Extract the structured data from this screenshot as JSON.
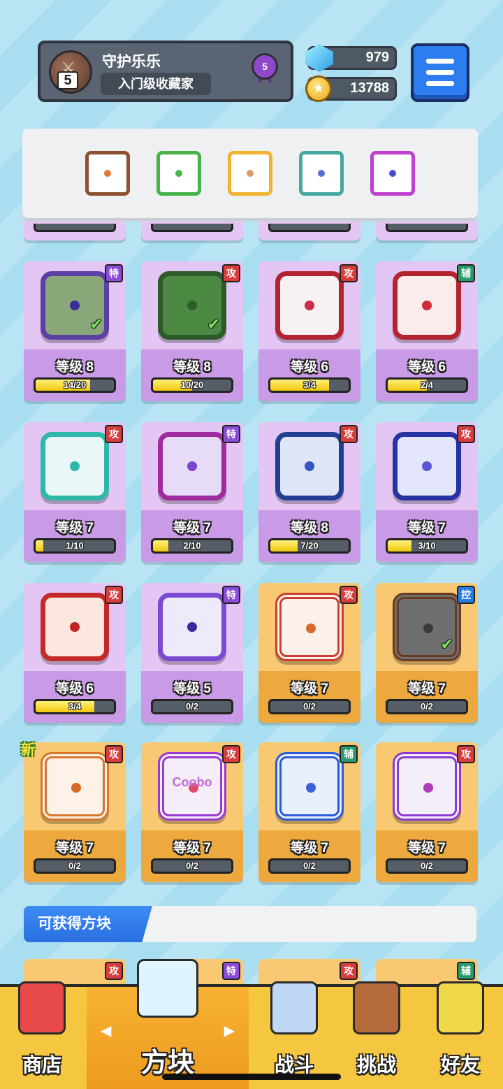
{
  "profile": {
    "username": "守护乐乐",
    "title": "入门级收藏家",
    "level": "5",
    "rank": "5"
  },
  "currency": {
    "gems": "979",
    "gold": "13788"
  },
  "deck": [
    {
      "name": "dragon-earth-dice",
      "border": "#8a5230",
      "dot": "#e07a3a"
    },
    {
      "name": "radiation-dice",
      "border": "#49b34a",
      "dot": "#4bb44b"
    },
    {
      "name": "sun-dice",
      "border": "#f1b431",
      "dot": "#d89a6a"
    },
    {
      "name": "healing-dice",
      "border": "#47a8a0",
      "dot": "#5b6bd8"
    },
    {
      "name": "rainbow-dice",
      "border": "#c040d0",
      "dot": "#4a4ad8"
    }
  ],
  "cards": [
    {
      "tag": "特",
      "tag_type": "spe",
      "level": "等级 8",
      "progress": "14/20",
      "fill": 0.7,
      "style": "purple",
      "border": "#5b3fa3",
      "pip": "#3b2f9a",
      "face": "#8aa77a",
      "check": true,
      "new": false
    },
    {
      "tag": "攻",
      "tag_type": "atk",
      "level": "等级 8",
      "progress": "10/20",
      "fill": 0.5,
      "style": "purple",
      "border": "#2e5a2a",
      "pip": "#2f5c2c",
      "face": "#4c8a44",
      "check": true,
      "new": false
    },
    {
      "tag": "攻",
      "tag_type": "atk",
      "level": "等级 6",
      "progress": "3/4",
      "fill": 0.75,
      "style": "purple",
      "border": "#b32430",
      "pip": "#c8304a",
      "face": "#f7f1f1",
      "check": false,
      "new": false
    },
    {
      "tag": "辅",
      "tag_type": "sup",
      "level": "等级 6",
      "progress": "2/4",
      "fill": 0.5,
      "style": "purple",
      "border": "#b32430",
      "pip": "#d02c3c",
      "face": "#fbecec",
      "check": false,
      "new": false
    },
    {
      "tag": "攻",
      "tag_type": "atk",
      "level": "等级 7",
      "progress": "1/10",
      "fill": 0.1,
      "style": "purple",
      "border": "#2fb8aa",
      "pip": "#2fb8aa",
      "face": "#e9f8f6",
      "check": false,
      "new": false
    },
    {
      "tag": "特",
      "tag_type": "spe",
      "level": "等级 7",
      "progress": "2/10",
      "fill": 0.2,
      "style": "purple",
      "border": "#a02a9f",
      "pip": "#7a44d0",
      "face": "#e7dcf7",
      "check": false,
      "new": false
    },
    {
      "tag": "攻",
      "tag_type": "atk",
      "level": "等级 8",
      "progress": "7/20",
      "fill": 0.35,
      "style": "purple",
      "border": "#233f94",
      "pip": "#3456c3",
      "face": "#dfe6f7",
      "check": false,
      "new": false
    },
    {
      "tag": "攻",
      "tag_type": "atk",
      "level": "等级 7",
      "progress": "3/10",
      "fill": 0.3,
      "style": "purple",
      "border": "#2733a2",
      "pip": "#5a56d9",
      "face": "#e4e7fb",
      "check": false,
      "new": false
    },
    {
      "tag": "攻",
      "tag_type": "atk",
      "level": "等级 6",
      "progress": "3/4",
      "fill": 0.75,
      "style": "purple",
      "border": "#c52a2a",
      "pip": "#c02424",
      "face": "#fbe7dd",
      "check": false,
      "new": false
    },
    {
      "tag": "特",
      "tag_type": "spe",
      "level": "等级 5",
      "progress": "0/2",
      "fill": 0,
      "style": "purple",
      "border": "#7a4ad0",
      "pip": "#3a2a9c",
      "face": "#eee9fb",
      "check": false,
      "new": false
    },
    {
      "tag": "攻",
      "tag_type": "atk",
      "level": "等级 7",
      "progress": "0/2",
      "fill": 0,
      "style": "gold",
      "border": "#cf3d2e",
      "pip": "#d96a2e",
      "face": "#fbf0ea",
      "check": false,
      "new": false
    },
    {
      "tag": "控",
      "tag_type": "ctl",
      "level": "等级 7",
      "progress": "0/2",
      "fill": 0,
      "style": "gold",
      "border": "#6b3a20",
      "pip": "#3a3a3a",
      "face": "#6f6f6f",
      "check": true,
      "new": false
    },
    {
      "tag": "攻",
      "tag_type": "atk",
      "level": "等级 7",
      "progress": "0/2",
      "fill": 0,
      "style": "gold",
      "border": "#d8762a",
      "pip": "#d86a24",
      "face": "#fdf2e8",
      "check": false,
      "new": true,
      "new_label": "新"
    },
    {
      "tag": "攻",
      "tag_type": "atk",
      "level": "等级 7",
      "progress": "0/2",
      "fill": 0,
      "style": "gold",
      "border": "#9a3ad0",
      "pip": "#e04a6a",
      "face": "#f5eef8",
      "check": false,
      "new": false,
      "face_text": "Coobo"
    },
    {
      "tag": "辅",
      "tag_type": "sup",
      "level": "等级 7",
      "progress": "0/2",
      "fill": 0,
      "style": "gold",
      "border": "#2a5ad8",
      "pip": "#3a62d8",
      "face": "#e9f0fd",
      "check": false,
      "new": false
    },
    {
      "tag": "攻",
      "tag_type": "atk",
      "level": "等级 7",
      "progress": "0/2",
      "fill": 0,
      "style": "gold",
      "border": "#8a3ad0",
      "pip": "#b03ab8",
      "face": "#f4eefb",
      "check": false,
      "new": false
    }
  ],
  "obtainable": {
    "label": "可获得方块",
    "preview_tags": [
      {
        "tag": "攻",
        "tag_type": "atk"
      },
      {
        "tag": "特",
        "tag_type": "spe"
      },
      {
        "tag": "攻",
        "tag_type": "atk"
      },
      {
        "tag": "辅",
        "tag_type": "sup"
      }
    ]
  },
  "nav": {
    "shop": "商店",
    "dice": "方块",
    "battle": "战斗",
    "challenge": "挑战",
    "friends": "好友",
    "prev_arrow": "◀",
    "next_arrow": "▶"
  }
}
